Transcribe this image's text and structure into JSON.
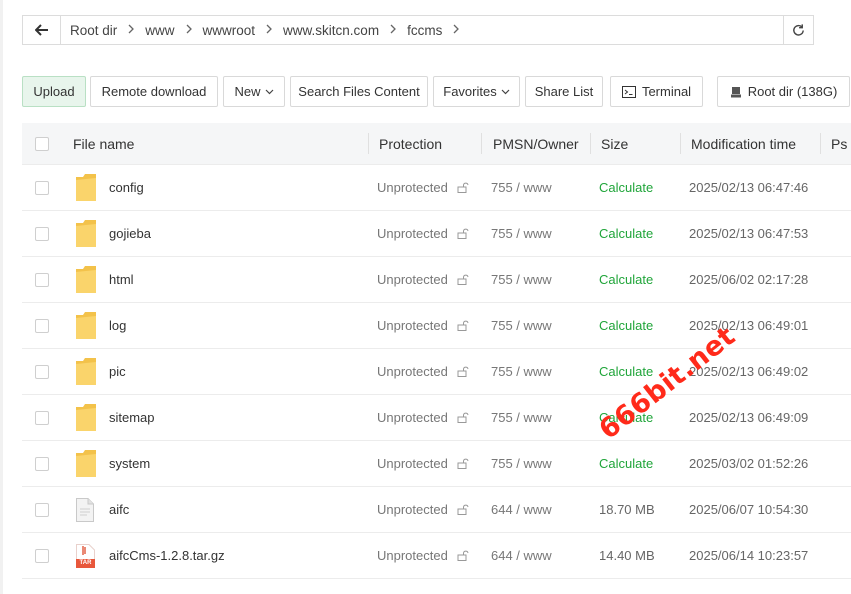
{
  "breadcrumb": {
    "items": [
      "Root dir",
      "www",
      "wwwroot",
      "www.skitcn.com",
      "fccms"
    ]
  },
  "toolbar": {
    "upload": "Upload",
    "remote_download": "Remote download",
    "new": "New",
    "search": "Search Files Content",
    "favorites": "Favorites",
    "share_list": "Share List",
    "terminal": "Terminal",
    "root_dir": "Root dir (138G)"
  },
  "table": {
    "headers": {
      "name": "File name",
      "protection": "Protection",
      "owner": "PMSN/Owner",
      "size": "Size",
      "mtime": "Modification time",
      "ps": "Ps"
    },
    "rows": [
      {
        "name": "config",
        "type": "folder",
        "protection": "Unprotected",
        "owner": "755 / www",
        "size": "Calculate",
        "mtime": "2025/02/13 06:47:46"
      },
      {
        "name": "gojieba",
        "type": "folder",
        "protection": "Unprotected",
        "owner": "755 / www",
        "size": "Calculate",
        "mtime": "2025/02/13 06:47:53"
      },
      {
        "name": "html",
        "type": "folder",
        "protection": "Unprotected",
        "owner": "755 / www",
        "size": "Calculate",
        "mtime": "2025/06/02 02:17:28"
      },
      {
        "name": "log",
        "type": "folder",
        "protection": "Unprotected",
        "owner": "755 / www",
        "size": "Calculate",
        "mtime": "2025/02/13 06:49:01"
      },
      {
        "name": "pic",
        "type": "folder",
        "protection": "Unprotected",
        "owner": "755 / www",
        "size": "Calculate",
        "mtime": "2025/02/13 06:49:02"
      },
      {
        "name": "sitemap",
        "type": "folder",
        "protection": "Unprotected",
        "owner": "755 / www",
        "size": "Calculate",
        "mtime": "2025/02/13 06:49:09"
      },
      {
        "name": "system",
        "type": "folder",
        "protection": "Unprotected",
        "owner": "755 / www",
        "size": "Calculate",
        "mtime": "2025/03/02 01:52:26"
      },
      {
        "name": "aifc",
        "type": "file",
        "protection": "Unprotected",
        "owner": "644 / www",
        "size": "18.70 MB",
        "mtime": "2025/06/07 10:54:30"
      },
      {
        "name": "aifcCms-1.2.8.tar.gz",
        "type": "archive",
        "protection": "Unprotected",
        "owner": "644 / www",
        "size": "14.40 MB",
        "mtime": "2025/06/14 10:23:57"
      }
    ]
  },
  "archive_badge": "TAR",
  "watermark": "666bit.net",
  "colors": {
    "accent": "#20a53a",
    "folder": "#f7c948",
    "watermark": "#ff2a1a"
  }
}
